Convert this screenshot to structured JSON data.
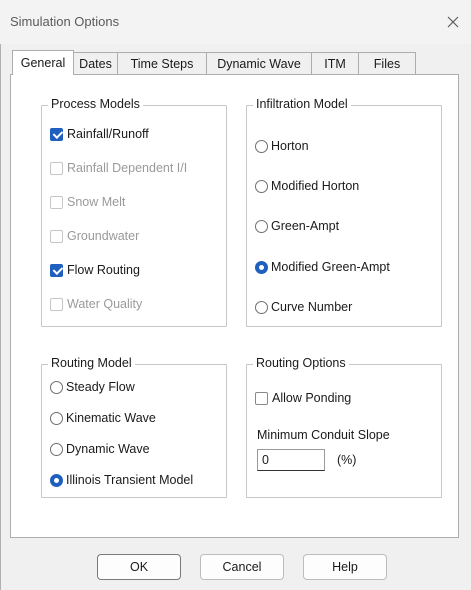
{
  "window": {
    "title": "Simulation Options",
    "close_icon": "close-icon"
  },
  "tabs": [
    {
      "label": "General",
      "active": true
    },
    {
      "label": "Dates",
      "active": false
    },
    {
      "label": "Time Steps",
      "active": false
    },
    {
      "label": "Dynamic Wave",
      "active": false
    },
    {
      "label": "ITM",
      "active": false
    },
    {
      "label": "Files",
      "active": false
    }
  ],
  "process_models": {
    "legend": "Process Models",
    "items": [
      {
        "label": "Rainfall/Runoff",
        "checked": true,
        "enabled": true
      },
      {
        "label": "Rainfall Dependent I/I",
        "checked": false,
        "enabled": false
      },
      {
        "label": "Snow Melt",
        "checked": false,
        "enabled": false
      },
      {
        "label": "Groundwater",
        "checked": false,
        "enabled": false
      },
      {
        "label": "Flow Routing",
        "checked": true,
        "enabled": true
      },
      {
        "label": "Water Quality",
        "checked": false,
        "enabled": false
      }
    ]
  },
  "infiltration_model": {
    "legend": "Infiltration Model",
    "options": [
      {
        "label": "Horton",
        "selected": false
      },
      {
        "label": "Modified Horton",
        "selected": false
      },
      {
        "label": "Green-Ampt",
        "selected": false
      },
      {
        "label": "Modified Green-Ampt",
        "selected": true
      },
      {
        "label": "Curve Number",
        "selected": false
      }
    ]
  },
  "routing_model": {
    "legend": "Routing Model",
    "options": [
      {
        "label": "Steady Flow",
        "selected": false
      },
      {
        "label": "Kinematic Wave",
        "selected": false
      },
      {
        "label": "Dynamic Wave",
        "selected": false
      },
      {
        "label": "Illinois Transient Model",
        "selected": true
      }
    ]
  },
  "routing_options": {
    "legend": "Routing Options",
    "allow_ponding_label": "Allow Ponding",
    "allow_ponding_checked": false,
    "min_slope_label": "Minimum Conduit Slope",
    "min_slope_value": "0",
    "min_slope_unit": "(%)"
  },
  "buttons": {
    "ok": "OK",
    "cancel": "Cancel",
    "help": "Help"
  },
  "colors": {
    "accent": "#1f5fbf",
    "disabled_text": "#9a9a9a"
  }
}
